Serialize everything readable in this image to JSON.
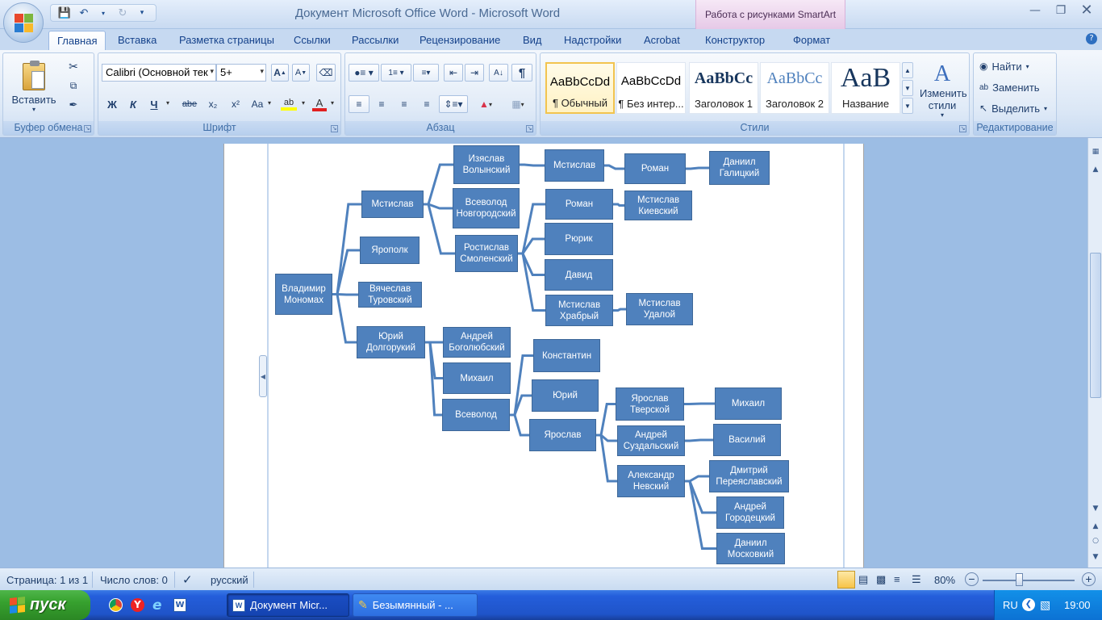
{
  "window": {
    "title": "Документ Microsoft Office Word - Microsoft Word",
    "context_tab_title": "Работа с рисунками SmartArt"
  },
  "ribbon_tabs": [
    "Главная",
    "Вставка",
    "Разметка страницы",
    "Ссылки",
    "Рассылки",
    "Рецензирование",
    "Вид",
    "Надстройки",
    "Acrobat",
    "Конструктор",
    "Формат"
  ],
  "ribbon": {
    "clipboard": {
      "label": "Буфер обмена",
      "paste": "Вставить"
    },
    "font": {
      "label": "Шрифт",
      "font_name": "Calibri (Основной тек",
      "font_size": "5+",
      "bold": "Ж",
      "italic": "К",
      "underline": "Ч",
      "strike": "abe",
      "sub": "x₂",
      "sup": "x²",
      "case": "Aa"
    },
    "paragraph": {
      "label": "Абзац"
    },
    "styles": {
      "label": "Стили",
      "items": [
        {
          "sample": "AaBbCcDd",
          "name": "¶ Обычный"
        },
        {
          "sample": "AaBbCcDd",
          "name": "¶ Без интер..."
        },
        {
          "sample": "AaBbCc",
          "name": "Заголовок 1"
        },
        {
          "sample": "AaBbCc",
          "name": "Заголовок 2"
        },
        {
          "sample": "AaB",
          "name": "Название"
        }
      ],
      "change_styles": "Изменить стили"
    },
    "editing": {
      "label": "Редактирование",
      "find": "Найти",
      "replace": "Заменить",
      "select": "Выделить"
    }
  },
  "tree": {
    "nodes": [
      {
        "id": "n1",
        "text": "Владимир Мономах"
      },
      {
        "id": "n2",
        "text": "Мстислав"
      },
      {
        "id": "n3",
        "text": "Ярополк"
      },
      {
        "id": "n4",
        "text": "Вячеслав Туровский"
      },
      {
        "id": "n5",
        "text": "Юрий Долгорукий"
      },
      {
        "id": "n6",
        "text": "Изяслав Волынский"
      },
      {
        "id": "n7",
        "text": "Всеволод Новгородский"
      },
      {
        "id": "n8",
        "text": "Ростислав Смоленский"
      },
      {
        "id": "n9",
        "text": "Мстислав"
      },
      {
        "id": "n10",
        "text": "Роман"
      },
      {
        "id": "n11",
        "text": "Даниил Галицкий"
      },
      {
        "id": "n12",
        "text": "Роман"
      },
      {
        "id": "n13",
        "text": "Мстислав Киевский"
      },
      {
        "id": "n14",
        "text": "Рюрик"
      },
      {
        "id": "n15",
        "text": "Давид"
      },
      {
        "id": "n16",
        "text": "Мстислав Храбрый"
      },
      {
        "id": "n17",
        "text": "Мстислав Удалой"
      },
      {
        "id": "n18",
        "text": "Андрей Боголюбский"
      },
      {
        "id": "n19",
        "text": "Михаил"
      },
      {
        "id": "n20",
        "text": "Всеволод"
      },
      {
        "id": "n21",
        "text": "Константин"
      },
      {
        "id": "n22",
        "text": "Юрий"
      },
      {
        "id": "n23",
        "text": "Ярослав"
      },
      {
        "id": "n24",
        "text": "Ярослав Тверской"
      },
      {
        "id": "n25",
        "text": "Михаил"
      },
      {
        "id": "n26",
        "text": "Андрей Суздальский"
      },
      {
        "id": "n27",
        "text": "Василий"
      },
      {
        "id": "n28",
        "text": "Александр Невский"
      },
      {
        "id": "n29",
        "text": "Дмитрий Переяславский"
      },
      {
        "id": "n30",
        "text": "Андрей Городецкий"
      },
      {
        "id": "n31",
        "text": "Даниил Московкий"
      }
    ],
    "edges": [
      [
        "n1",
        "n2"
      ],
      [
        "n1",
        "n3"
      ],
      [
        "n1",
        "n4"
      ],
      [
        "n1",
        "n5"
      ],
      [
        "n2",
        "n6"
      ],
      [
        "n2",
        "n7"
      ],
      [
        "n2",
        "n8"
      ],
      [
        "n6",
        "n9"
      ],
      [
        "n9",
        "n10"
      ],
      [
        "n10",
        "n11"
      ],
      [
        "n8",
        "n12"
      ],
      [
        "n8",
        "n14"
      ],
      [
        "n8",
        "n15"
      ],
      [
        "n8",
        "n16"
      ],
      [
        "n12",
        "n13"
      ],
      [
        "n16",
        "n17"
      ],
      [
        "n5",
        "n18"
      ],
      [
        "n5",
        "n19"
      ],
      [
        "n5",
        "n20"
      ],
      [
        "n20",
        "n21"
      ],
      [
        "n20",
        "n22"
      ],
      [
        "n20",
        "n23"
      ],
      [
        "n23",
        "n24"
      ],
      [
        "n23",
        "n26"
      ],
      [
        "n23",
        "n28"
      ],
      [
        "n24",
        "n25"
      ],
      [
        "n26",
        "n27"
      ],
      [
        "n28",
        "n29"
      ],
      [
        "n28",
        "n30"
      ],
      [
        "n28",
        "n31"
      ]
    ]
  },
  "statusbar": {
    "page": "Страница: 1 из 1",
    "words": "Число слов: 0",
    "language": "русский",
    "zoom": "80%"
  },
  "taskbar": {
    "start": "пуск",
    "tasks": [
      "Документ Micr...",
      "Безымянный - ..."
    ],
    "lang": "RU",
    "clock": "19:00"
  },
  "colors": {
    "node_fill": "#4f81bd",
    "connector": "#4f81bd",
    "taskbar": "#245edb",
    "start": "#37a12f"
  }
}
